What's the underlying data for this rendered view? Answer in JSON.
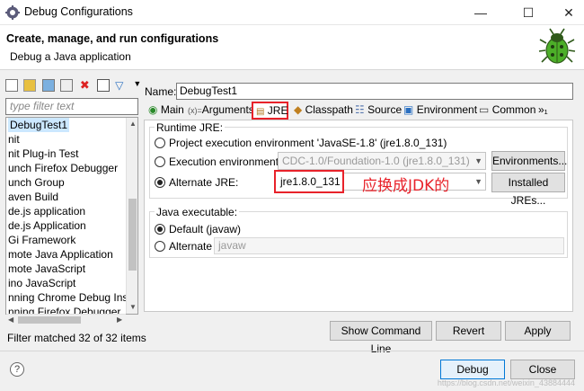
{
  "window": {
    "title": "Debug Configurations"
  },
  "header": {
    "title": "Create, manage, and run configurations",
    "subtitle": "Debug a Java application"
  },
  "left_panel": {
    "filter_placeholder": "type filter text",
    "tree_items": [
      {
        "label": "DebugTest1",
        "selected": true
      },
      {
        "label": "nit"
      },
      {
        "label": "nit Plug-in Test"
      },
      {
        "label": "unch Firefox Debugger"
      },
      {
        "label": "unch Group"
      },
      {
        "label": "aven Build"
      },
      {
        "label": "de.js application"
      },
      {
        "label": "de.js Application"
      },
      {
        "label": "Gi Framework"
      },
      {
        "label": "mote Java Application"
      },
      {
        "label": "mote JavaScript"
      },
      {
        "label": "ino JavaScript"
      },
      {
        "label": "nning Chrome Debug Insta"
      },
      {
        "label": "nning Firefox Debugger"
      }
    ],
    "filter_matched": "Filter matched 32 of 32 items"
  },
  "config": {
    "name_label": "Name:",
    "name_value": "DebugTest1",
    "tabs": [
      "Main",
      "Arguments",
      "JRE",
      "Classpath",
      "Source",
      "Environment",
      "Common",
      "»₁"
    ],
    "runtime_jre": {
      "label": "Runtime JRE:",
      "project_env": "Project execution environment 'JavaSE-1.8' (jre1.8.0_131)",
      "exec_env_label": "Execution environment:",
      "exec_env_value": "CDC-1.0/Foundation-1.0 (jre1.8.0_131)",
      "environments_button": "Environments...",
      "alternate_label": "Alternate JRE:",
      "alternate_value": "jre1.8.0_131",
      "installed_button": "Installed JREs...",
      "annotation": "应换成JDK的"
    },
    "java_executable": {
      "label": "Java executable:",
      "default_label": "Default (javaw)",
      "alternate_label": "Alternate",
      "alternate_value": "javaw"
    },
    "buttons": {
      "show_cmd": "Show Command Line",
      "revert": "Revert",
      "apply": "Apply"
    }
  },
  "footer": {
    "help": "?",
    "debug": "Debug",
    "close": "Close",
    "watermark": "https://blog.csdn.net/weixin_43884444"
  },
  "colors": {
    "accent": "#0078d7",
    "annotation": "#e8222a",
    "selection": "#cce8ff"
  }
}
